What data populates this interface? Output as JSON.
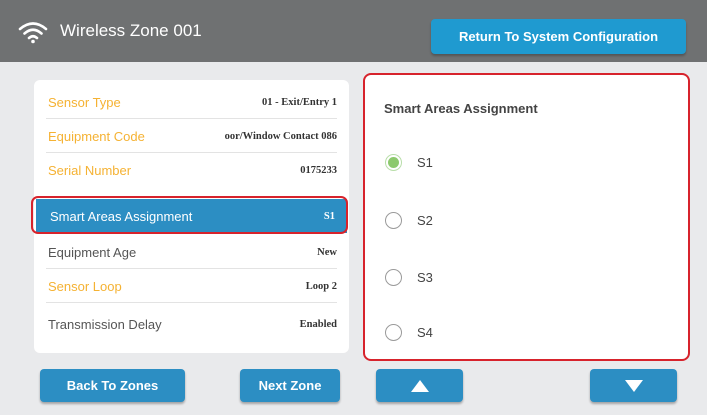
{
  "header": {
    "title": "Wireless Zone 001",
    "icon": "wifi-icon",
    "return_label": "Return To System Configuration"
  },
  "details": {
    "rows": [
      {
        "label": "Sensor Type",
        "value": "01 - Exit/Entry 1"
      },
      {
        "label": "Equipment Code",
        "value": "oor/Window Contact  086"
      },
      {
        "label": "Serial Number",
        "value": "0175233"
      },
      {
        "label": "Smart Areas Assignment",
        "value": "S1"
      },
      {
        "label": "Equipment Age",
        "value": "New"
      },
      {
        "label": "Sensor Loop",
        "value": "Loop 2"
      },
      {
        "label": "Transmission Delay",
        "value": "Enabled"
      }
    ]
  },
  "assignment": {
    "title": "Smart Areas Assignment",
    "options": [
      "S1",
      "S2",
      "S3",
      "S4"
    ],
    "selected": "S1"
  },
  "footer": {
    "back_label": "Back To Zones",
    "next_label": "Next Zone",
    "up_icon": "up-arrow-icon",
    "down_icon": "down-arrow-icon"
  },
  "colors": {
    "header": "#6f7172",
    "accent": "#2c8ec3",
    "label_orange": "#f5b233",
    "highlight": "#d7232c",
    "radio_selected": "#8cc96d"
  }
}
